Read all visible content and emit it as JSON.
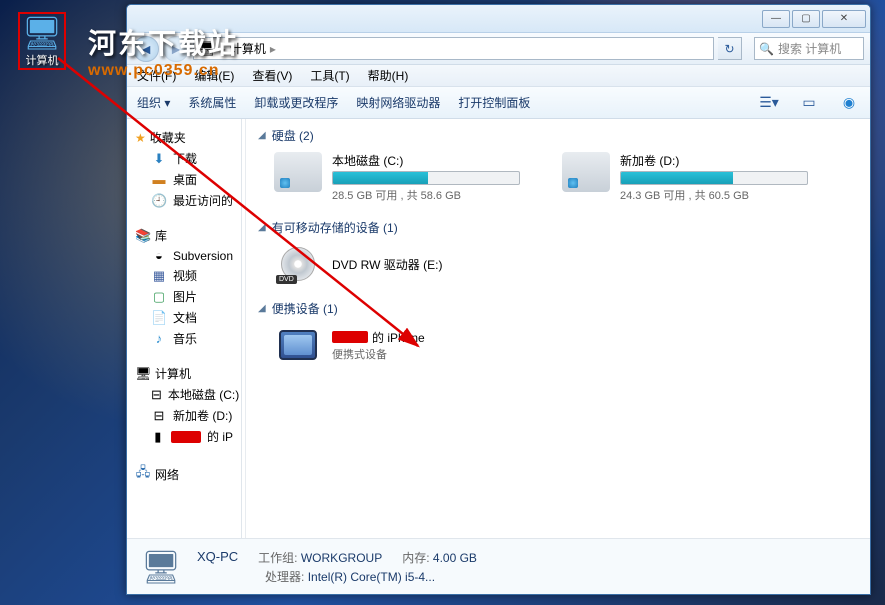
{
  "desktop": {
    "icon_label": "计算机"
  },
  "watermark": {
    "line1": "河东下载站",
    "line2": "www.pc0359.cn"
  },
  "titlebar": {
    "min": "—",
    "max": "▢",
    "close": "✕"
  },
  "nav": {
    "back": "◄",
    "forward": "►",
    "crumb1": "计算机",
    "crumb_sep": "▸",
    "refresh": "↻",
    "search_placeholder": "搜索 计算机"
  },
  "menu": {
    "file": "文件(F)",
    "edit": "编辑(E)",
    "view": "查看(V)",
    "tools": "工具(T)",
    "help": "帮助(H)"
  },
  "toolbar": {
    "organize": "组织 ▾",
    "properties": "系统属性",
    "uninstall": "卸载或更改程序",
    "map_drive": "映射网络驱动器",
    "control_panel": "打开控制面板"
  },
  "sidebar": {
    "favorites": {
      "label": "收藏夹",
      "items": [
        "下载",
        "桌面",
        "最近访问的"
      ]
    },
    "libraries": {
      "label": "库",
      "items": [
        "Subversion",
        "视频",
        "图片",
        "文档",
        "音乐"
      ]
    },
    "computer": {
      "label": "计算机",
      "items": [
        "本地磁盘 (C:)",
        "新加卷 (D:)"
      ],
      "iphone_suffix": "的 iP"
    },
    "network": {
      "label": "网络"
    }
  },
  "content": {
    "hdd_header": "硬盘 (2)",
    "drives": [
      {
        "name": "本地磁盘 (C:)",
        "free": "28.5 GB 可用 , 共 58.6 GB",
        "fill_pct": 51
      },
      {
        "name": "新加卷 (D:)",
        "free": "24.3 GB 可用 , 共 60.5 GB",
        "fill_pct": 60
      }
    ],
    "removable_header": "有可移动存储的设备 (1)",
    "dvd": {
      "name": "DVD RW 驱动器 (E:)",
      "badge": "DVD"
    },
    "portable_header": "便携设备 (1)",
    "iphone": {
      "name_suffix": "的 iPhone",
      "sub": "便携式设备"
    }
  },
  "status": {
    "pc_name": "XQ-PC",
    "workgroup_label": "工作组:",
    "workgroup": "WORKGROUP",
    "mem_label": "内存:",
    "mem": "4.00 GB",
    "cpu_label": "处理器:",
    "cpu": "Intel(R) Core(TM) i5-4..."
  }
}
